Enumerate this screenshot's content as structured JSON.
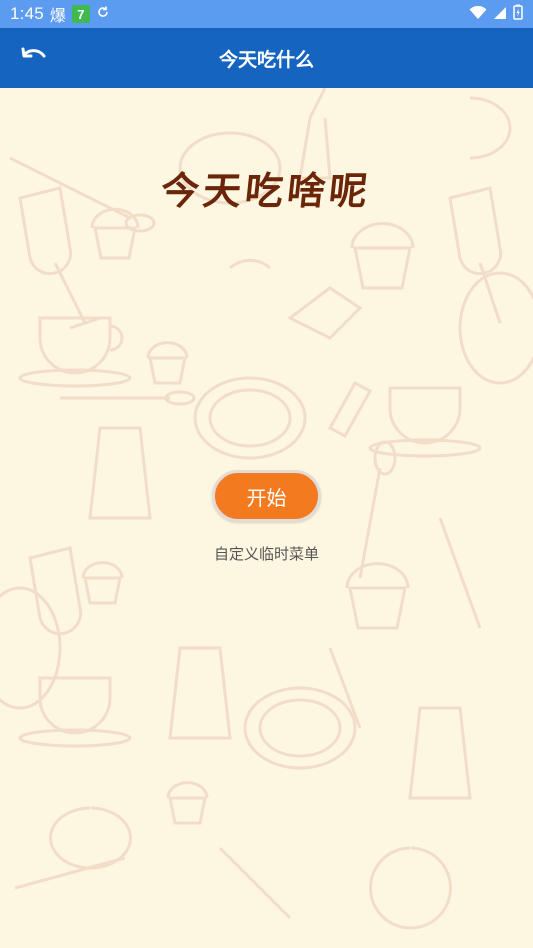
{
  "status_bar": {
    "time": "1:45",
    "app_glyph": "爆",
    "badge_text": "7",
    "sync_icon": "sync-icon",
    "wifi_icon": "wifi-icon",
    "signal_icon": "signal-icon",
    "battery_icon": "battery-charging-icon"
  },
  "app_bar": {
    "title": "今天吃什么",
    "back_icon": "undo-arrow-icon",
    "color": "#1565c0"
  },
  "main": {
    "hero_title": "今天吃啥呢",
    "start_button": "开始",
    "custom_menu_link": "自定义临时菜单",
    "accent_color": "#f47a20",
    "background_color": "#fdf6e0"
  }
}
